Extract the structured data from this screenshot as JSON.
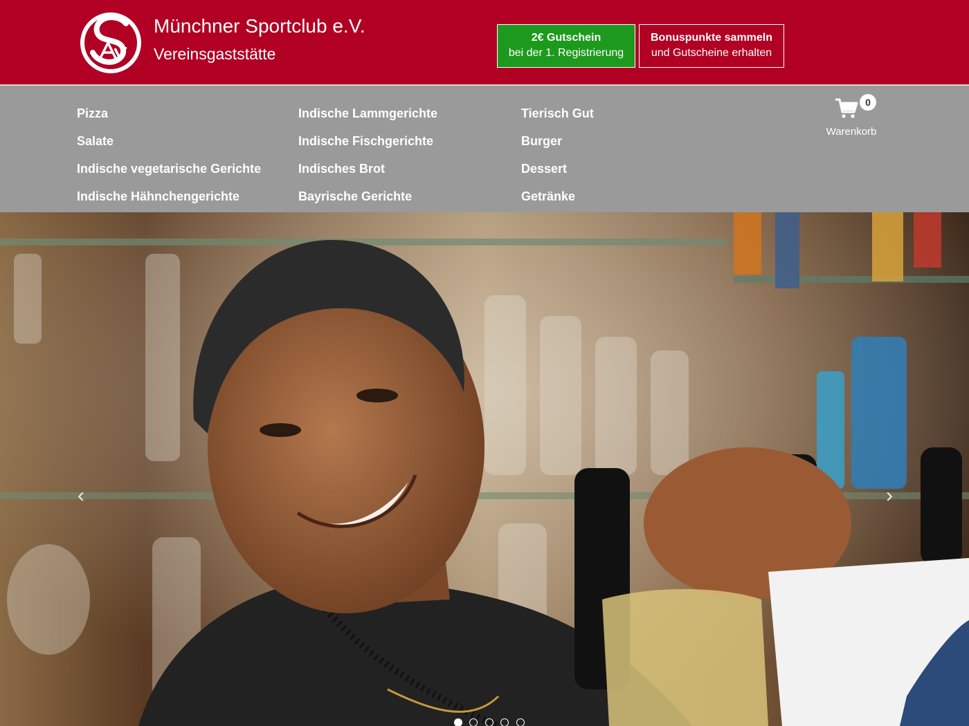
{
  "header": {
    "club_name": "Münchner Sportclub e.V.",
    "club_subtitle": "Vereinsgaststätte",
    "promo_voucher": {
      "line1": "2€ Gutschein",
      "line2": "bei der 1. Registrierung"
    },
    "promo_points": {
      "line1": "Bonuspunkte sammeln",
      "line2": "und Gutscheine erhalten"
    }
  },
  "nav": {
    "col1": [
      "Pizza",
      "Salate",
      "Indische vegetarische Gerichte",
      "Indische Hähnchengerichte"
    ],
    "col2": [
      "Indische Lammgerichte",
      "Indische Fischgerichte",
      "Indisches Brot",
      "Bayrische Gerichte"
    ],
    "col3": [
      "Tierisch Gut",
      "Burger",
      "Dessert",
      "Getränke"
    ]
  },
  "cart": {
    "count": "0",
    "label": "Warenkorb"
  },
  "slider": {
    "prev_icon": "chevron-left-icon",
    "next_icon": "chevron-right-icon",
    "slide_count": 5,
    "active_slide": 1
  },
  "colors": {
    "brand_red": "#b10023",
    "promo_green": "#1d9a1d",
    "nav_gray": "#9a9a9a"
  }
}
